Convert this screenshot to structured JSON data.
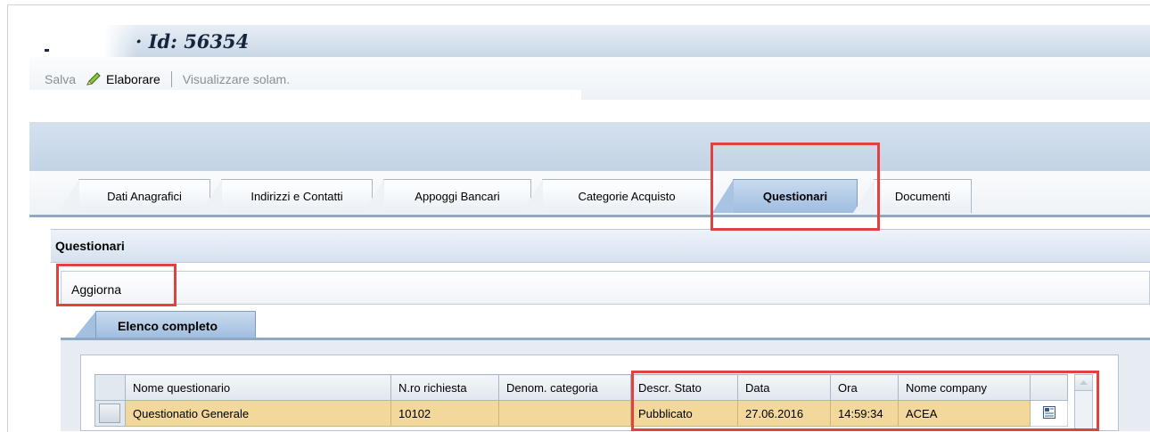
{
  "header": {
    "title": "· Id: 56354"
  },
  "toolbar": {
    "save_label": "Salva",
    "edit_label": "Elaborare",
    "view_only_label": "Visualizzare solam."
  },
  "tabs": [
    {
      "label": "Dati Anagrafici",
      "active": false
    },
    {
      "label": "Indirizzi e Contatti",
      "active": false
    },
    {
      "label": "Appoggi Bancari",
      "active": false
    },
    {
      "label": "Categorie Acquisto",
      "active": false
    },
    {
      "label": "Questionari",
      "active": true
    },
    {
      "label": "Documenti",
      "active": false
    }
  ],
  "questionari": {
    "section_title": "Questionari",
    "refresh_label": "Aggiorna",
    "subtab_label": "Elenco completo",
    "table": {
      "columns": [
        "Nome questionario",
        "N.ro richiesta",
        "Denom. categoria",
        "Descr. Stato",
        "Data",
        "Ora",
        "Nome company"
      ],
      "rows": [
        [
          "Questionatio Generale",
          "10102",
          "",
          "Pubblicato",
          "27.06.2016",
          "14:59:34",
          "ACEA"
        ]
      ]
    }
  },
  "colors": {
    "highlight": "#e0433f",
    "selected_row": "#f2d89a",
    "active_tab": "#9fbde0"
  },
  "icons": [
    "pencil-icon",
    "detail-icon",
    "scroll-up-icon"
  ]
}
